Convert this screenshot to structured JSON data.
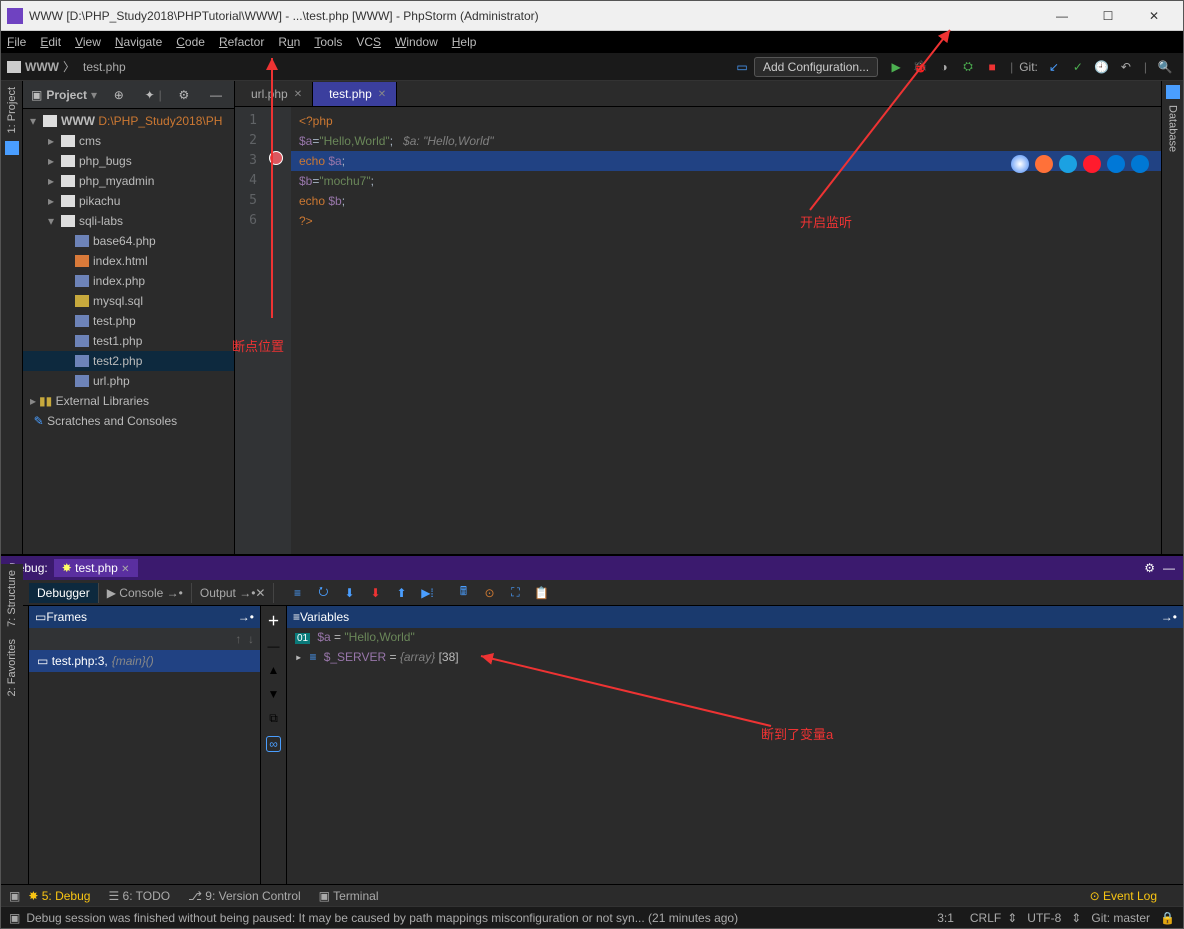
{
  "window": {
    "title": "WWW [D:\\PHP_Study2018\\PHPTutorial\\WWW] - ...\\test.php [WWW] - PhpStorm (Administrator)"
  },
  "menu": [
    "File",
    "Edit",
    "View",
    "Navigate",
    "Code",
    "Refactor",
    "Run",
    "Tools",
    "VCS",
    "Window",
    "Help"
  ],
  "breadcrumb": {
    "root": "WWW",
    "file": "test.php"
  },
  "toolbar": {
    "addConfig": "Add Configuration...",
    "git": "Git:"
  },
  "project": {
    "title": "Project",
    "root": "WWW",
    "rootPath": "D:\\PHP_Study2018\\PH",
    "items": [
      {
        "name": "cms",
        "type": "folder",
        "depth": 2
      },
      {
        "name": "php_bugs",
        "type": "folder",
        "depth": 2
      },
      {
        "name": "php_myadmin",
        "type": "folder",
        "depth": 2
      },
      {
        "name": "pikachu",
        "type": "folder",
        "depth": 2
      },
      {
        "name": "sqli-labs",
        "type": "folder",
        "depth": 2,
        "open": true
      },
      {
        "name": "base64.php",
        "type": "php",
        "depth": 3
      },
      {
        "name": "index.html",
        "type": "html",
        "depth": 3
      },
      {
        "name": "index.php",
        "type": "php",
        "depth": 3
      },
      {
        "name": "mysql.sql",
        "type": "sql",
        "depth": 3
      },
      {
        "name": "test.php",
        "type": "php",
        "depth": 3
      },
      {
        "name": "test1.php",
        "type": "php",
        "depth": 3
      },
      {
        "name": "test2.php",
        "type": "php",
        "depth": 3,
        "sel": true
      },
      {
        "name": "url.php",
        "type": "php",
        "depth": 3
      }
    ],
    "ext": "External Libraries",
    "scratch": "Scratches and Consoles"
  },
  "tabs": [
    {
      "label": "url.php",
      "active": false
    },
    {
      "label": "test.php",
      "active": true
    }
  ],
  "code": {
    "lines": [
      "<?php",
      "$a=\"Hello,World\";   $a: \"Hello,World\"",
      "echo $a;",
      "$b=\"mochu7\";",
      "echo $b;",
      "?>"
    ],
    "currentLine": 3,
    "breakpointLine": 3
  },
  "annotations": {
    "breakpoint": "断点位置",
    "listen": "开启监听",
    "varhit": "断到了变量a"
  },
  "leftTool": {
    "label": "1: Project"
  },
  "rightTool": {
    "label": "Database"
  },
  "debug": {
    "title": "Debug:",
    "tab": "test.php",
    "subtabs": {
      "debugger": "Debugger",
      "console": "Console",
      "output": "Output"
    },
    "frames": {
      "title": "Frames",
      "item": "test.php:3,",
      "main": "{main}()"
    },
    "vars": {
      "title": "Variables",
      "a_name": "$a",
      "a_eq": " = ",
      "a_val": "\"Hello,World\"",
      "s_name": "$_SERVER",
      "s_eq": " = ",
      "s_type": "{array}",
      "s_len": " [38]"
    }
  },
  "bottom": {
    "debug": "5: Debug",
    "todo": "6: TODO",
    "vcs": "9: Version Control",
    "terminal": "Terminal",
    "eventlog": "Event Log"
  },
  "status": {
    "msg": "Debug session was finished without being paused: It may be caused by path mappings misconfiguration or not syn... (21 minutes ago)",
    "pos": "3:1",
    "crlf": "CRLF",
    "enc": "UTF-8",
    "git": "Git: master",
    "lock": "🔒"
  }
}
